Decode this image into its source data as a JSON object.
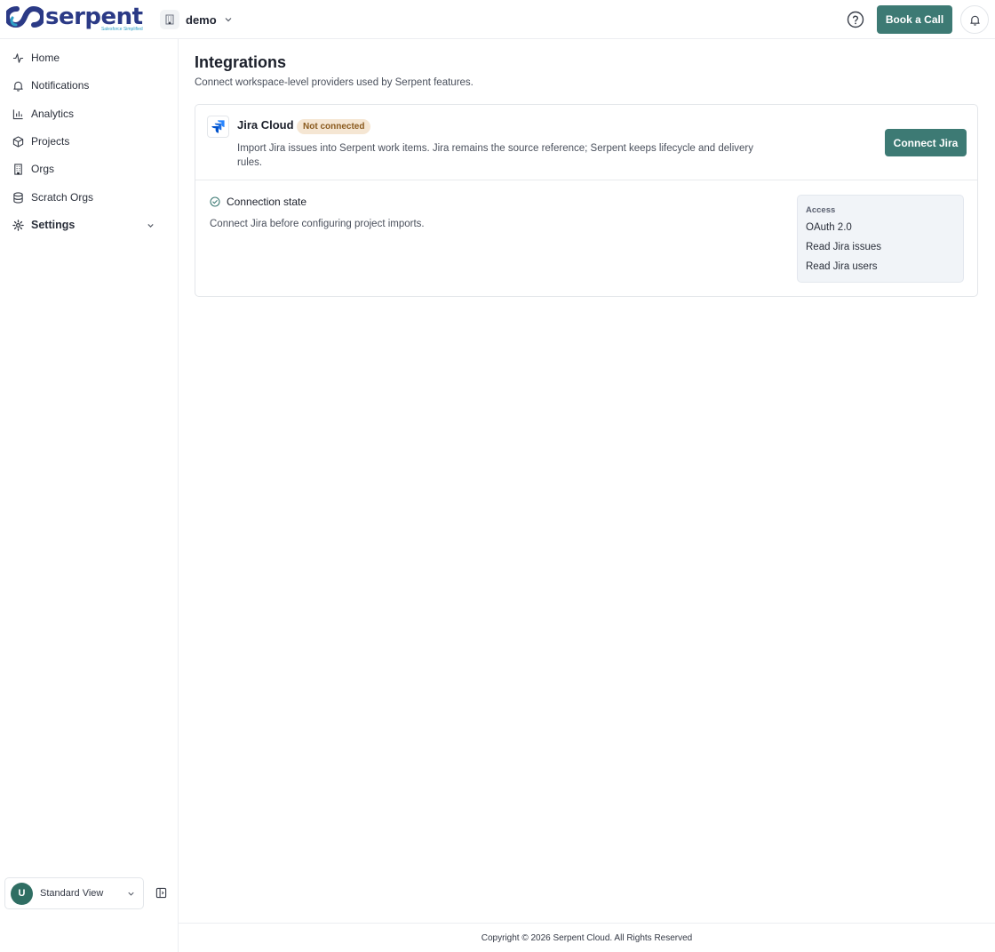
{
  "header": {
    "logo": {
      "word": "serpent",
      "tagline": "Salesforce Simplified"
    },
    "workspace": {
      "name": "demo",
      "icon": "building-icon"
    },
    "help_icon": "help-circle-icon",
    "book_call_label": "Book a Call",
    "bell_icon": "bell-icon"
  },
  "sidebar": {
    "items": [
      {
        "label": "Home",
        "icon": "activity-icon"
      },
      {
        "label": "Notifications",
        "icon": "bell-icon"
      },
      {
        "label": "Analytics",
        "icon": "bar-chart-icon"
      },
      {
        "label": "Projects",
        "icon": "box-icon"
      },
      {
        "label": "Orgs",
        "icon": "building-icon"
      },
      {
        "label": "Scratch Orgs",
        "icon": "database-icon"
      },
      {
        "label": "Settings",
        "icon": "gear-icon"
      }
    ],
    "user": {
      "initial": "U",
      "view_label": "Standard View"
    }
  },
  "main": {
    "title": "Integrations",
    "subtitle": "Connect workspace-level providers used by Serpent features.",
    "provider": {
      "name": "Jira Cloud",
      "status": "Not connected",
      "description": "Import Jira issues into Serpent work items. Jira remains the source reference; Serpent keeps lifecycle and delivery rules.",
      "connect_label": "Connect Jira",
      "state_title": "Connection state",
      "state_desc": "Connect Jira before configuring project imports.",
      "access": {
        "title": "Access",
        "items": [
          "OAuth 2.0",
          "Read Jira issues",
          "Read Jira users"
        ]
      }
    }
  },
  "footer": {
    "copyright": "Copyright © 2026 Serpent Cloud. All Rights Reserved"
  },
  "colors": {
    "brand_navy": "#2b3a86",
    "accent_teal": "#3d7a74",
    "badge_bg": "#f5e6d3",
    "badge_text": "#8a5a1e"
  }
}
